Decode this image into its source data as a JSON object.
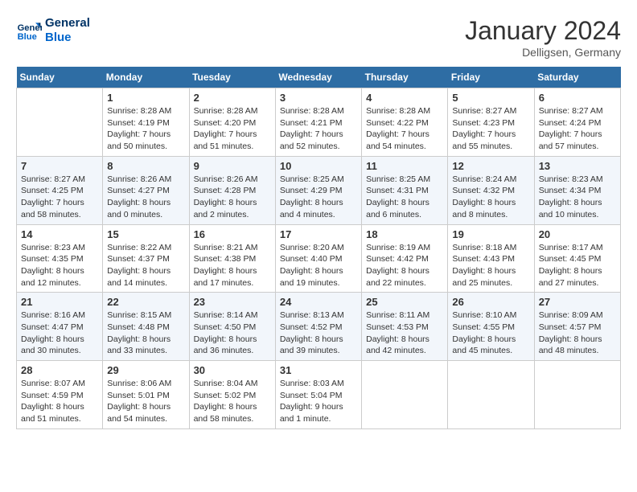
{
  "header": {
    "logo_line1": "General",
    "logo_line2": "Blue",
    "month": "January 2024",
    "location": "Delligsen, Germany"
  },
  "days_of_week": [
    "Sunday",
    "Monday",
    "Tuesday",
    "Wednesday",
    "Thursday",
    "Friday",
    "Saturday"
  ],
  "weeks": [
    [
      {
        "day": "",
        "info": ""
      },
      {
        "day": "1",
        "info": "Sunrise: 8:28 AM\nSunset: 4:19 PM\nDaylight: 7 hours\nand 50 minutes."
      },
      {
        "day": "2",
        "info": "Sunrise: 8:28 AM\nSunset: 4:20 PM\nDaylight: 7 hours\nand 51 minutes."
      },
      {
        "day": "3",
        "info": "Sunrise: 8:28 AM\nSunset: 4:21 PM\nDaylight: 7 hours\nand 52 minutes."
      },
      {
        "day": "4",
        "info": "Sunrise: 8:28 AM\nSunset: 4:22 PM\nDaylight: 7 hours\nand 54 minutes."
      },
      {
        "day": "5",
        "info": "Sunrise: 8:27 AM\nSunset: 4:23 PM\nDaylight: 7 hours\nand 55 minutes."
      },
      {
        "day": "6",
        "info": "Sunrise: 8:27 AM\nSunset: 4:24 PM\nDaylight: 7 hours\nand 57 minutes."
      }
    ],
    [
      {
        "day": "7",
        "info": "Sunrise: 8:27 AM\nSunset: 4:25 PM\nDaylight: 7 hours\nand 58 minutes."
      },
      {
        "day": "8",
        "info": "Sunrise: 8:26 AM\nSunset: 4:27 PM\nDaylight: 8 hours\nand 0 minutes."
      },
      {
        "day": "9",
        "info": "Sunrise: 8:26 AM\nSunset: 4:28 PM\nDaylight: 8 hours\nand 2 minutes."
      },
      {
        "day": "10",
        "info": "Sunrise: 8:25 AM\nSunset: 4:29 PM\nDaylight: 8 hours\nand 4 minutes."
      },
      {
        "day": "11",
        "info": "Sunrise: 8:25 AM\nSunset: 4:31 PM\nDaylight: 8 hours\nand 6 minutes."
      },
      {
        "day": "12",
        "info": "Sunrise: 8:24 AM\nSunset: 4:32 PM\nDaylight: 8 hours\nand 8 minutes."
      },
      {
        "day": "13",
        "info": "Sunrise: 8:23 AM\nSunset: 4:34 PM\nDaylight: 8 hours\nand 10 minutes."
      }
    ],
    [
      {
        "day": "14",
        "info": "Sunrise: 8:23 AM\nSunset: 4:35 PM\nDaylight: 8 hours\nand 12 minutes."
      },
      {
        "day": "15",
        "info": "Sunrise: 8:22 AM\nSunset: 4:37 PM\nDaylight: 8 hours\nand 14 minutes."
      },
      {
        "day": "16",
        "info": "Sunrise: 8:21 AM\nSunset: 4:38 PM\nDaylight: 8 hours\nand 17 minutes."
      },
      {
        "day": "17",
        "info": "Sunrise: 8:20 AM\nSunset: 4:40 PM\nDaylight: 8 hours\nand 19 minutes."
      },
      {
        "day": "18",
        "info": "Sunrise: 8:19 AM\nSunset: 4:42 PM\nDaylight: 8 hours\nand 22 minutes."
      },
      {
        "day": "19",
        "info": "Sunrise: 8:18 AM\nSunset: 4:43 PM\nDaylight: 8 hours\nand 25 minutes."
      },
      {
        "day": "20",
        "info": "Sunrise: 8:17 AM\nSunset: 4:45 PM\nDaylight: 8 hours\nand 27 minutes."
      }
    ],
    [
      {
        "day": "21",
        "info": "Sunrise: 8:16 AM\nSunset: 4:47 PM\nDaylight: 8 hours\nand 30 minutes."
      },
      {
        "day": "22",
        "info": "Sunrise: 8:15 AM\nSunset: 4:48 PM\nDaylight: 8 hours\nand 33 minutes."
      },
      {
        "day": "23",
        "info": "Sunrise: 8:14 AM\nSunset: 4:50 PM\nDaylight: 8 hours\nand 36 minutes."
      },
      {
        "day": "24",
        "info": "Sunrise: 8:13 AM\nSunset: 4:52 PM\nDaylight: 8 hours\nand 39 minutes."
      },
      {
        "day": "25",
        "info": "Sunrise: 8:11 AM\nSunset: 4:53 PM\nDaylight: 8 hours\nand 42 minutes."
      },
      {
        "day": "26",
        "info": "Sunrise: 8:10 AM\nSunset: 4:55 PM\nDaylight: 8 hours\nand 45 minutes."
      },
      {
        "day": "27",
        "info": "Sunrise: 8:09 AM\nSunset: 4:57 PM\nDaylight: 8 hours\nand 48 minutes."
      }
    ],
    [
      {
        "day": "28",
        "info": "Sunrise: 8:07 AM\nSunset: 4:59 PM\nDaylight: 8 hours\nand 51 minutes."
      },
      {
        "day": "29",
        "info": "Sunrise: 8:06 AM\nSunset: 5:01 PM\nDaylight: 8 hours\nand 54 minutes."
      },
      {
        "day": "30",
        "info": "Sunrise: 8:04 AM\nSunset: 5:02 PM\nDaylight: 8 hours\nand 58 minutes."
      },
      {
        "day": "31",
        "info": "Sunrise: 8:03 AM\nSunset: 5:04 PM\nDaylight: 9 hours\nand 1 minute."
      },
      {
        "day": "",
        "info": ""
      },
      {
        "day": "",
        "info": ""
      },
      {
        "day": "",
        "info": ""
      }
    ]
  ]
}
